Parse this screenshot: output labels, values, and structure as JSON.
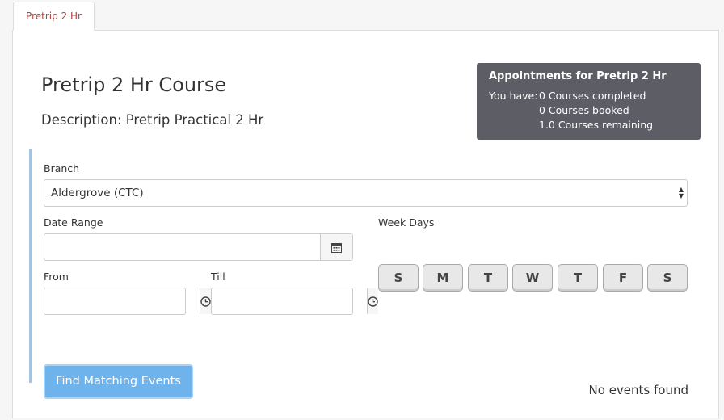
{
  "tabs": [
    {
      "label": "Pretrip 2 Hr"
    }
  ],
  "course": {
    "title": "Pretrip 2 Hr Course",
    "description": "Description: Pretrip Practical 2 Hr"
  },
  "appointments": {
    "title": "Appointments for Pretrip 2 Hr",
    "prefix": "You have:",
    "completed": "0 Courses completed",
    "booked": "0 Courses booked",
    "remaining": "1.0 Courses remaining"
  },
  "form": {
    "branch_label": "Branch",
    "branch_value": "Aldergrove (CTC)",
    "date_range_label": "Date Range",
    "date_range_value": "",
    "week_days_label": "Week Days",
    "week_days": [
      "S",
      "M",
      "T",
      "W",
      "T",
      "F",
      "S"
    ],
    "from_label": "From",
    "from_value": "",
    "till_label": "Till",
    "till_value": "",
    "find_button": "Find Matching Events"
  },
  "results": {
    "status": "No events found"
  },
  "colors": {
    "tab_active_text": "#a94442",
    "appointments_bg": "#5d5d66",
    "primary_button": "#6fb3ed",
    "form_accent_border": "#a8c3e0"
  },
  "icons": {
    "date_range_addon": "calendar-icon",
    "from_addon": "clock-icon",
    "till_addon": "clock-icon",
    "branch_select": "select-arrows-icon"
  }
}
